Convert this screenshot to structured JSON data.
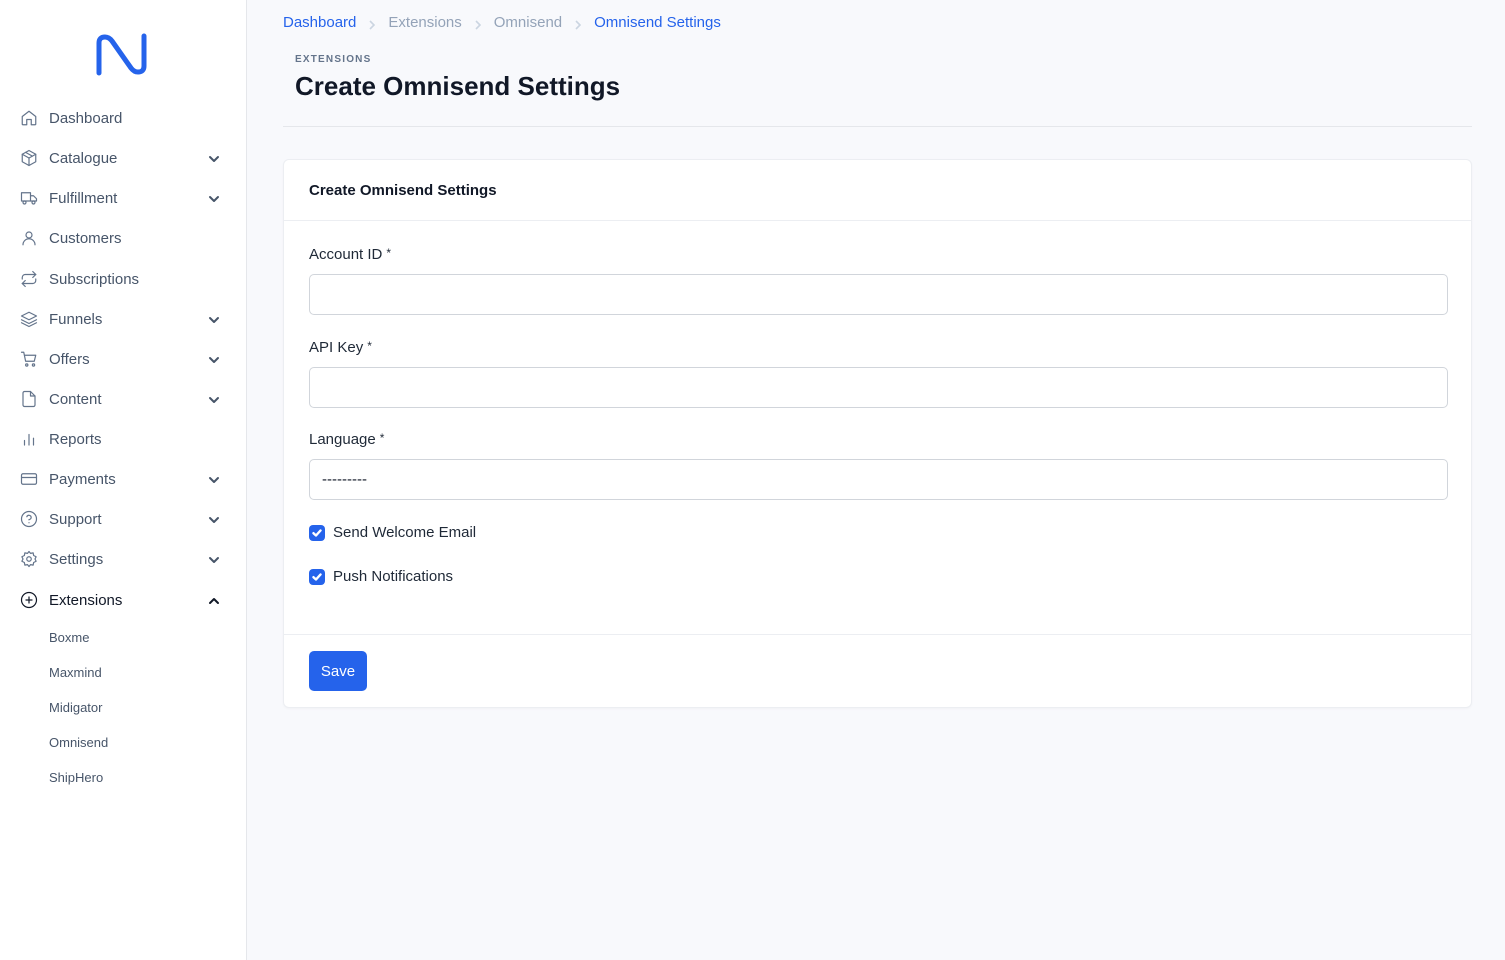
{
  "brand": {
    "accent": "#2563eb",
    "logo_icon": "omnisend-logo-icon"
  },
  "sidebar": {
    "items": [
      {
        "label": "Dashboard",
        "icon": "home-icon",
        "expandable": false
      },
      {
        "label": "Catalogue",
        "icon": "box-icon",
        "expandable": true
      },
      {
        "label": "Fulfillment",
        "icon": "truck-icon",
        "expandable": true
      },
      {
        "label": "Customers",
        "icon": "user-icon",
        "expandable": false
      },
      {
        "label": "Subscriptions",
        "icon": "repeat-icon",
        "expandable": false
      },
      {
        "label": "Funnels",
        "icon": "layers-icon",
        "expandable": true
      },
      {
        "label": "Offers",
        "icon": "cart-icon",
        "expandable": true
      },
      {
        "label": "Content",
        "icon": "file-icon",
        "expandable": true
      },
      {
        "label": "Reports",
        "icon": "bar-chart-icon",
        "expandable": false
      },
      {
        "label": "Payments",
        "icon": "credit-card-icon",
        "expandable": true
      },
      {
        "label": "Support",
        "icon": "help-circle-icon",
        "expandable": true
      },
      {
        "label": "Settings",
        "icon": "gear-icon",
        "expandable": true
      },
      {
        "label": "Extensions",
        "icon": "plus-circle-icon",
        "expandable": true,
        "expanded": true
      }
    ],
    "extensions_subitems": [
      "Boxme",
      "Maxmind",
      "Midigator",
      "Omnisend",
      "ShipHero"
    ]
  },
  "breadcrumb": [
    "Dashboard",
    "Extensions",
    "Omnisend",
    "Omnisend Settings"
  ],
  "header": {
    "eyebrow": "EXTENSIONS",
    "title": "Create Omnisend Settings"
  },
  "form": {
    "card_title": "Create Omnisend Settings",
    "account_id": {
      "label": "Account ID",
      "required_mark": "*",
      "value": ""
    },
    "api_key": {
      "label": "API Key",
      "required_mark": "*",
      "value": ""
    },
    "language": {
      "label": "Language",
      "required_mark": "*",
      "selected": "---------"
    },
    "send_welcome_email": {
      "label": "Send Welcome Email",
      "checked": true
    },
    "push_notifications": {
      "label": "Push Notifications",
      "checked": true
    },
    "save_label": "Save"
  }
}
